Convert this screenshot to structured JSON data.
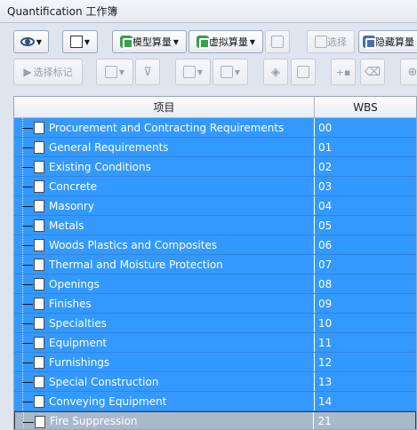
{
  "window": {
    "title": "Quantification 工作簿"
  },
  "toolbar": {
    "model_takeoff": "模型算量",
    "virtual_takeoff": "虚拟算量",
    "select": "选择",
    "hide_takeoff": "隐藏算量",
    "select_markup": "选择标记"
  },
  "grid": {
    "headers": {
      "item": "项目",
      "wbs": "WBS"
    },
    "rows": [
      {
        "label": "Procurement and Contracting Requirements",
        "wbs": "00"
      },
      {
        "label": "General Requirements",
        "wbs": "01"
      },
      {
        "label": "Existing Conditions",
        "wbs": "02"
      },
      {
        "label": "Concrete",
        "wbs": "03"
      },
      {
        "label": "Masonry",
        "wbs": "04"
      },
      {
        "label": "Metals",
        "wbs": "05"
      },
      {
        "label": "Woods Plastics and Composites",
        "wbs": "06"
      },
      {
        "label": "Thermal and Moisture Protection",
        "wbs": "07"
      },
      {
        "label": "Openings",
        "wbs": "08"
      },
      {
        "label": "Finishes",
        "wbs": "09"
      },
      {
        "label": "Specialties",
        "wbs": "10"
      },
      {
        "label": "Equipment",
        "wbs": "11"
      },
      {
        "label": "Furnishings",
        "wbs": "12"
      },
      {
        "label": "Special Construction",
        "wbs": "13"
      },
      {
        "label": "Conveying Equipment",
        "wbs": "14"
      },
      {
        "label": "Fire Suppression",
        "wbs": "21"
      }
    ]
  },
  "colors": {
    "selection": "#3399ff",
    "focused_row": "#a9b9cc"
  }
}
